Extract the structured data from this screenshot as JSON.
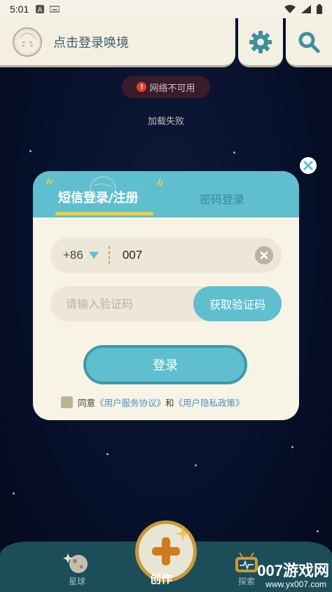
{
  "status_bar": {
    "time": "5:01"
  },
  "header": {
    "login_prompt": "点击登录唤境"
  },
  "background": {
    "network_error": "网络不可用",
    "load_failed": "加载失败"
  },
  "dialog": {
    "tabs": [
      {
        "label": "短信登录/注册",
        "active": true
      },
      {
        "label": "密码登录",
        "active": false
      }
    ],
    "phone": {
      "country_code": "+86",
      "value": "007"
    },
    "code": {
      "placeholder": "请输入验证码",
      "get_code_label": "获取验证码"
    },
    "login_label": "登录",
    "agreement": {
      "prefix": "同意",
      "user_agreement": "《用户服务协议》",
      "and": "和",
      "privacy_policy": "《用户隐私政策》"
    }
  },
  "bottom_nav": {
    "planet_label": "星球",
    "create_label": "创作",
    "explore_label": "探索"
  },
  "watermark": {
    "brand": "007游戏网",
    "url": "www.yx007.com"
  },
  "colors": {
    "accent": "#5fbfcf",
    "accent_dark": "#3f9aa8",
    "panel_bg": "#f7f3e5",
    "underline": "#f5cf3b",
    "error": "#e2432b"
  }
}
